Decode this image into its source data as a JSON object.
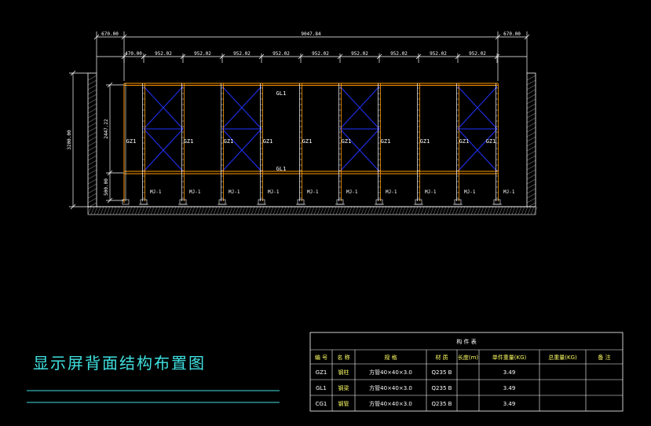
{
  "drawing_title": "显示屏背面结构布置图",
  "dimensions": {
    "overall_left": "670.00",
    "overall_mid": "9047.84",
    "overall_right": "670.00",
    "sub_first": "470.00",
    "sub_bays": [
      "952.02",
      "952.02",
      "952.02",
      "952.02",
      "952.02",
      "952.02",
      "952.02",
      "952.02",
      "952.02"
    ],
    "height_total": "3200.00",
    "height_upper": "2447.22",
    "height_lower": "500.00"
  },
  "member_labels": {
    "beam_top": "GL1",
    "beam_mid": "GL1",
    "columns": [
      "GZ1",
      "GZ1",
      "GZ1",
      "GZ1",
      "GZ1",
      "GZ1",
      "GZ1",
      "GZ1",
      "GZ1",
      "GZ1"
    ],
    "footings": [
      "MJ-1",
      "MJ-1",
      "MJ-1",
      "MJ-1",
      "MJ-1",
      "MJ-1",
      "MJ-1",
      "MJ-1",
      "MJ-1",
      "MJ-1"
    ]
  },
  "colors": {
    "frame": "#ff9a00",
    "bracing": "#2233ff",
    "lines": "#ffffff",
    "title": "#3fe0e0"
  },
  "material_table": {
    "caption": "构 件 表",
    "headers": [
      "编 号",
      "名 称",
      "规 格",
      "材 质",
      "长度(m)",
      "单件重量(KG)",
      "总重量(KG)",
      "备 注"
    ],
    "rows": [
      [
        "GZ1",
        "钢柱",
        "方管40×40×3.0",
        "Q235 B",
        "",
        "3.49",
        "",
        ""
      ],
      [
        "GL1",
        "钢梁",
        "方管40×40×3.0",
        "Q235 B",
        "",
        "3.49",
        "",
        ""
      ],
      [
        "CG1",
        "钢管",
        "方管40×40×3.0",
        "Q235 B",
        "",
        "3.49",
        "",
        ""
      ]
    ]
  }
}
